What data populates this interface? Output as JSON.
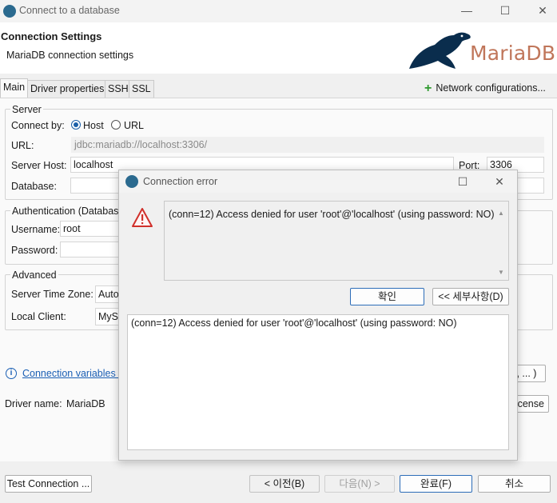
{
  "window": {
    "title": "Connect to a database",
    "minimize": "—",
    "maximize": "☐",
    "close": "✕"
  },
  "header": {
    "title": "Connection Settings",
    "subtitle": "MariaDB connection settings",
    "logo_text": "MariaDB"
  },
  "tabs": [
    {
      "label": "Main"
    },
    {
      "label": "Driver properties"
    },
    {
      "label": "SSH"
    },
    {
      "label": "SSL"
    }
  ],
  "network_config": {
    "label": "Network configurations..."
  },
  "server": {
    "group_title": "Server",
    "connect_by_label": "Connect by:",
    "host_option": "Host",
    "url_option": "URL",
    "url_label": "URL:",
    "url_value": "jdbc:mariadb://localhost:3306/",
    "host_label": "Server Host:",
    "host_value": "localhost",
    "port_label": "Port:",
    "port_value": "3306",
    "database_label": "Database:",
    "database_value": ""
  },
  "auth": {
    "group_title": "Authentication (Database",
    "username_label": "Username:",
    "username_value": "root",
    "password_label": "Password:",
    "password_value": ""
  },
  "advanced": {
    "group_title": "Advanced",
    "timezone_label": "Server Time Zone:",
    "timezone_value": "Auto",
    "client_label": "Local Client:",
    "client_value": "MyS"
  },
  "info": {
    "icon": "info-icon",
    "link_text": "Connection variables i",
    "right_button": "e, ... )"
  },
  "driver": {
    "label": "Driver name:",
    "value": "MariaDB",
    "license_button": "license"
  },
  "bottom": {
    "test_connection": "Test Connection ...",
    "back": "< 이전(B)",
    "next": "다음(N) >",
    "finish": "완료(F)",
    "cancel": "취소"
  },
  "dialog": {
    "title": "Connection error",
    "message": "(conn=12) Access denied for user 'root'@'localhost' (using password: NO)",
    "ok_button": "확인",
    "details_button": "<< 세부사항(D)",
    "detail_text": "(conn=12) Access denied for user 'root'@'localhost' (using password: NO)",
    "maximize": "☐",
    "close": "✕"
  },
  "colors": {
    "accent": "#1b5fa8",
    "link": "#1a5fb4",
    "warning": "#d0302b",
    "brand": "#c0765a"
  }
}
